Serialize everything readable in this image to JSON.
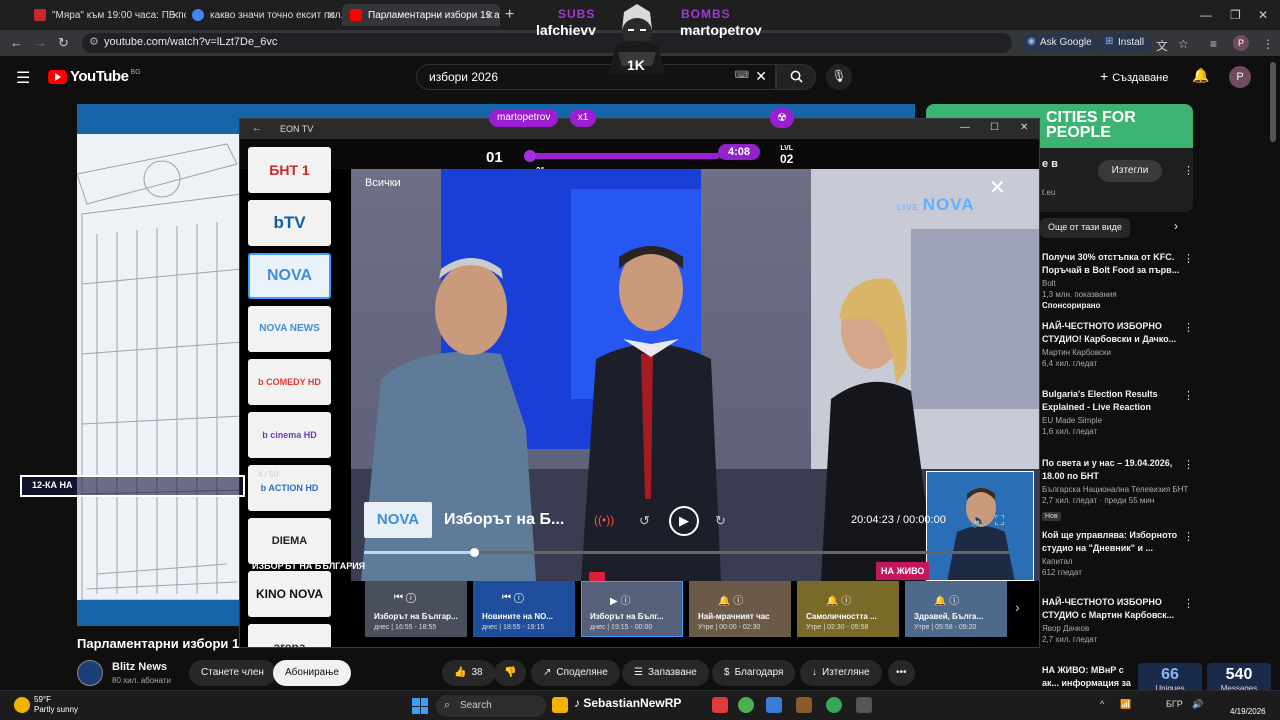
{
  "browser": {
    "tabs": [
      {
        "label": "\"Мяра\" към 19:00 часа: ПБ по...",
        "favicon_color": "#c62828"
      },
      {
        "label": "какво значи точно ексит пол...",
        "favicon_color": "#4285f4"
      },
      {
        "label": "Парламентарни избори 19 ап...",
        "favicon_color": "#ff0000"
      }
    ],
    "url": "youtube.com/watch?v=lLzt7De_6vc",
    "ask_google": "Ask Google",
    "install": "Install",
    "profile_initial": "P"
  },
  "youtube": {
    "logo_text": "YouTube",
    "country": "BG",
    "search_query": "избори 2026",
    "create_label": "Създаване",
    "avatar_initial": "P",
    "video_title": "Парламентарни избори 19",
    "channel_name": "Blitz News",
    "channel_subs": "80 хил. абонати",
    "join_label": "Станете член",
    "subscribe_label": "Абонирање",
    "likes": "38",
    "share_label": "Споделяне",
    "save_label": "Запазване",
    "thanks_label": "Благодаря",
    "download_label": "Изтегляне",
    "more_label": "•••",
    "ad": {
      "banner": "CITIES FOR PEOPLE",
      "text": "е в",
      "domain": "t.eu",
      "button": "Изтегли"
    },
    "chips": [
      "Още от тази виде",
      "›"
    ],
    "related": [
      {
        "title": "Получи 30% отстъпка от KFC. Поръчай в Bolt Food за първ...",
        "meta1": "Bolt",
        "meta2": "1,3 млн. показвания",
        "sponsored": "Спонсорирано"
      },
      {
        "title": "НАЙ-ЧЕСТНОТО ИЗБОРНО СТУДИО! Карбовски и Дачко...",
        "meta1": "Мартин Карбовски",
        "meta2": "6,4 хил. гледат"
      },
      {
        "title": "Bulgaria's Election Results Explained - Live Reaction",
        "meta1": "EU Made Simple",
        "meta2": "1,6 хил. гледат"
      },
      {
        "title": "По света и у нас – 19.04.2026, 18.00 по БНТ",
        "meta1": "Българска Национална Телевизия БНТ",
        "meta2": "2,7 хил. гледат · преди 55 мин",
        "badge": "Нов"
      },
      {
        "title": "Кой ще управлява: Изборното студио на \"Дневник\" и ...",
        "meta1": "Капитал",
        "meta2": "612 гледат"
      },
      {
        "title": "НАЙ-ЧЕСТНОТО ИЗБОРНО СТУДИО с Мартин Карбовск...",
        "meta1": "Явор Дачков",
        "meta2": "2,7 хил. гледат"
      },
      {
        "title": "НА ЖИВО: МВнР с ак... информация за вота",
        "meta1": "",
        "meta2": ""
      }
    ]
  },
  "eon": {
    "window_title": "EON TV",
    "filter_label": "Всички",
    "channels": [
      "БНТ 1",
      "bTV",
      "NOVA",
      "NOVA NEWS",
      "b COMEDY HD",
      "b cinema HD",
      "b ACTION HD",
      "DIEMA",
      "KINO NOVA",
      "arena"
    ],
    "selected_channel": "NOVA",
    "watermark": "NOVA",
    "current_channel_badge": "NOVA",
    "show_title": "Изборът на Б...",
    "timecode": "20:04:23 / 00:00:00",
    "seek_fraction": 0.17,
    "live_label": "НА ЖИВО",
    "section_label": "ИЗБОРЪТ НА БЪЛГАРИЯ",
    "programs": [
      {
        "title": "Изборът на Българ...",
        "time": "днес | 16:55 - 18:55"
      },
      {
        "title": "Новините на NO...",
        "time": "днес | 18:55 - 19:15"
      },
      {
        "title": "Изборът на Бълг...",
        "time": "днес | 19:15 - 00:00"
      },
      {
        "title": "Най-мрачният час",
        "time": "Утре | 00:00 - 02:30"
      },
      {
        "title": "Самоличността ...",
        "time": "Утре | 02:30 - 05:58"
      },
      {
        "title": "Здравей, Бълга...",
        "time": "Утре | 05:58 - 09:20"
      }
    ]
  },
  "overlay": {
    "subs_label": "SUBS",
    "subs_name": "lafchievv",
    "bombs_label": "BOMBS",
    "bombs_name": "martopetrov",
    "milestone": "1K",
    "level_current": "01",
    "level_sub": "21",
    "level_progress": 0.83,
    "level_timer": "4:08",
    "level_next_label": "LVL",
    "level_next": "02",
    "user_chip": "martopetrov",
    "multiplier": "x1",
    "banner_text": "12-КА НА",
    "banner_count": "4 / 50",
    "uniques": "66",
    "uniques_label": "Uniques",
    "messages": "540",
    "messages_label": "Messages"
  },
  "taskbar": {
    "temp": "59°F",
    "weather": "Partly sunny",
    "search": "Search",
    "overlay_name": "SebastianNewRP",
    "lang": "БГР",
    "time": "",
    "date": "4/19/2026"
  }
}
